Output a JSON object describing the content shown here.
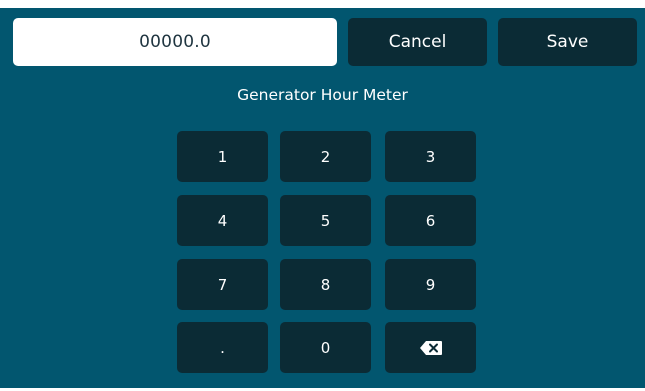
{
  "entry": {
    "value": "00000.0"
  },
  "actions": {
    "cancel_label": "Cancel",
    "save_label": "Save"
  },
  "title": "Generator Hour Meter",
  "keypad": {
    "keys": [
      "1",
      "2",
      "3",
      "4",
      "5",
      "6",
      "7",
      "8",
      "9",
      ".",
      "0"
    ],
    "backspace_icon": "backspace-icon"
  },
  "colors": {
    "background": "#02566f",
    "button": "#0b2b35",
    "field": "#ffffff",
    "text": "#ffffff"
  }
}
